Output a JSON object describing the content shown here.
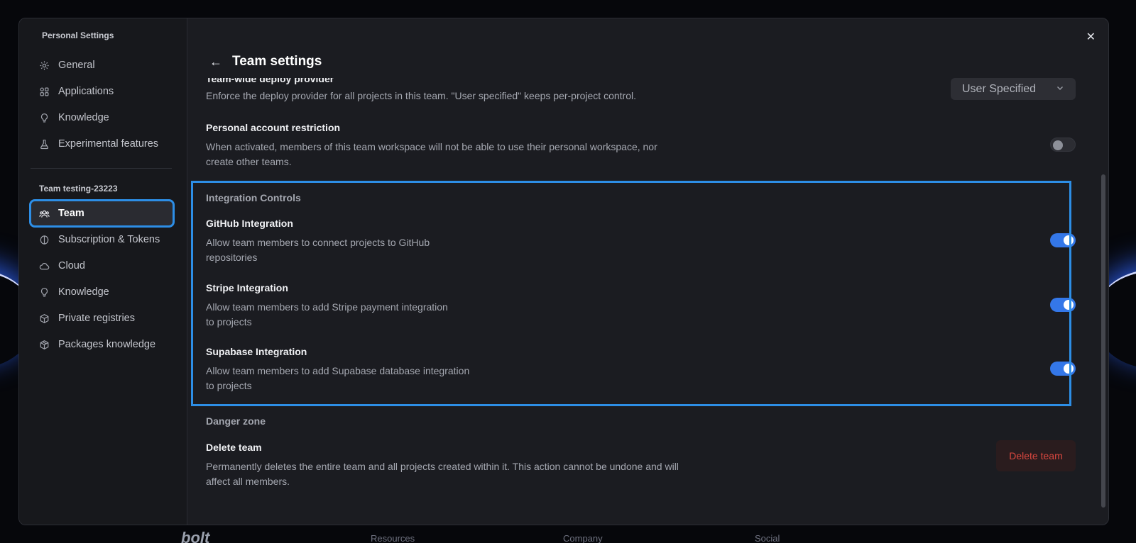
{
  "sidebar": {
    "personal_heading": "Personal Settings",
    "personal_items": [
      {
        "label": "General",
        "icon": "gear-icon"
      },
      {
        "label": "Applications",
        "icon": "apps-grid-icon"
      },
      {
        "label": "Knowledge",
        "icon": "lightbulb-icon"
      },
      {
        "label": "Experimental features",
        "icon": "flask-icon"
      }
    ],
    "team_heading": "Team testing-23223",
    "team_items": [
      {
        "label": "Team",
        "icon": "team-icon",
        "active": true
      },
      {
        "label": "Subscription & Tokens",
        "icon": "coin-icon"
      },
      {
        "label": "Cloud",
        "icon": "cloud-icon"
      },
      {
        "label": "Knowledge",
        "icon": "lightbulb-icon"
      },
      {
        "label": "Private registries",
        "icon": "box-icon"
      },
      {
        "label": "Packages knowledge",
        "icon": "package-icon"
      }
    ]
  },
  "header": {
    "title": "Team settings"
  },
  "deploy_provider": {
    "title": "Team-wide deploy provider",
    "description": "Enforce the deploy provider for all projects in this team. \"User specified\" keeps per-project control.",
    "selected": "User Specified"
  },
  "personal_restriction": {
    "title": "Personal account restriction",
    "description_line1": "When activated, members of this team workspace will not be able to use their personal workspace, nor",
    "description_line2": "create other teams.",
    "enabled": false
  },
  "integration_controls": {
    "label": "Integration Controls",
    "items": [
      {
        "title": "GitHub Integration",
        "line1": "Allow team members to connect projects to GitHub",
        "line2": "repositories",
        "enabled": true
      },
      {
        "title": "Stripe Integration",
        "line1": "Allow team members to add Stripe payment integration",
        "line2": "to projects",
        "enabled": true
      },
      {
        "title": "Supabase Integration",
        "line1": "Allow team members to add Supabase database integration",
        "line2": "to projects",
        "enabled": true
      }
    ]
  },
  "danger_zone": {
    "label": "Danger zone",
    "title": "Delete team",
    "line1": "Permanently deletes the entire team and all projects created within it. This action cannot be undone and will",
    "line2": "affect all members.",
    "button": "Delete team"
  },
  "footer": {
    "logo": "bolt",
    "columns": [
      "Resources",
      "Company",
      "Social"
    ]
  },
  "colors": {
    "accent": "#3477e8",
    "highlight": "#2d8ee6",
    "danger": "#d9473f"
  }
}
